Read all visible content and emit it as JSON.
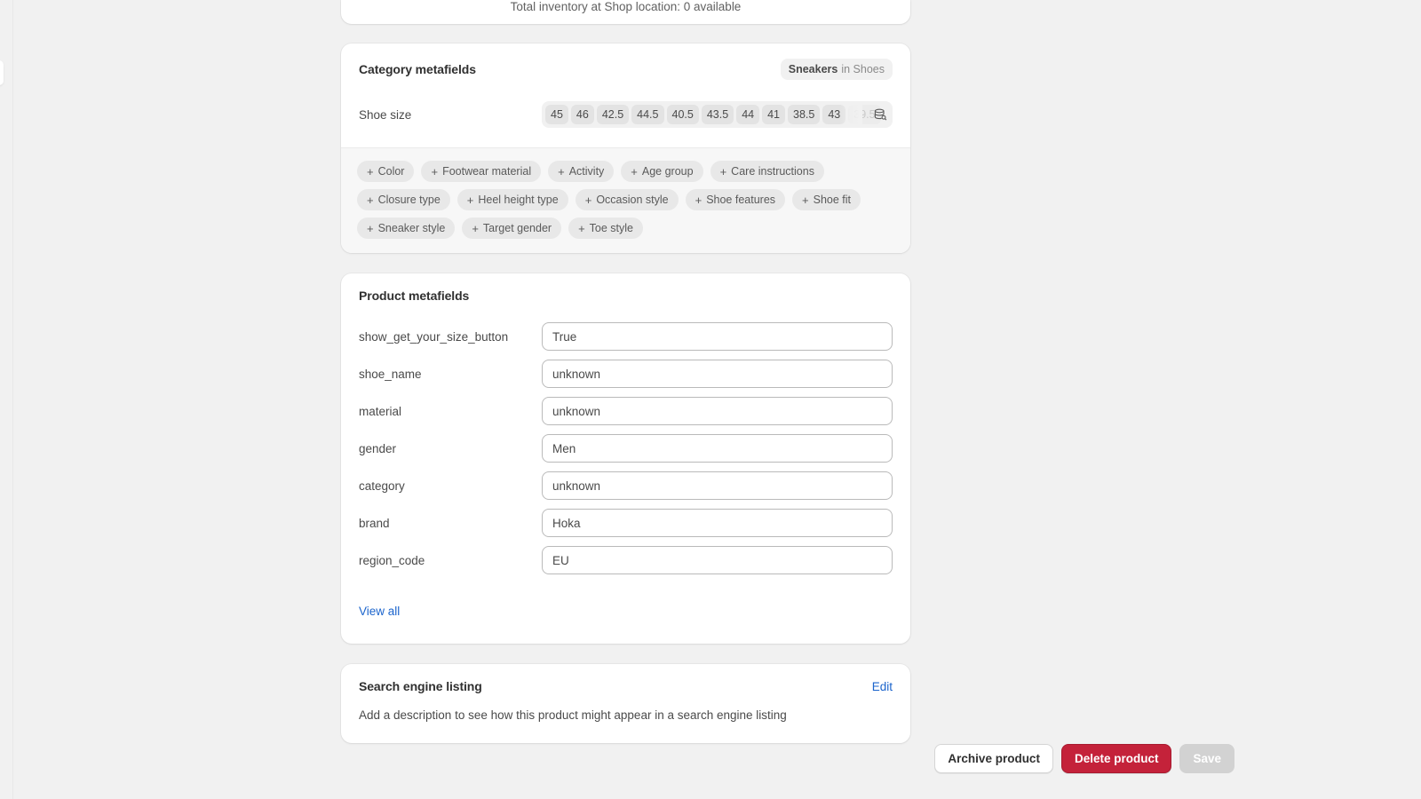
{
  "inventory": {
    "summary": "Total inventory at Shop location: 0 available"
  },
  "category_metafields": {
    "title": "Category metafields",
    "taxonomy_badge": {
      "category": "Sneakers",
      "suffix": "in Shoes"
    },
    "size_field": {
      "label": "Shoe size",
      "values": [
        "45",
        "46",
        "42.5",
        "44.5",
        "40.5",
        "43.5",
        "44",
        "41",
        "38.5",
        "43"
      ],
      "overflow_value": "39.5",
      "icon": "metafield-list-icon"
    },
    "add_chips": [
      "Color",
      "Footwear material",
      "Activity",
      "Age group",
      "Care instructions",
      "Closure type",
      "Heel height type",
      "Occasion style",
      "Shoe features",
      "Shoe fit",
      "Sneaker style",
      "Target gender",
      "Toe style"
    ]
  },
  "product_metafields": {
    "title": "Product metafields",
    "fields": [
      {
        "label": "show_get_your_size_button",
        "value": "True"
      },
      {
        "label": "shoe_name",
        "value": "unknown"
      },
      {
        "label": "material",
        "value": "unknown"
      },
      {
        "label": "gender",
        "value": "Men"
      },
      {
        "label": "category",
        "value": "unknown"
      },
      {
        "label": "brand",
        "value": "Hoka"
      },
      {
        "label": "region_code",
        "value": "EU"
      }
    ],
    "view_all_label": "View all"
  },
  "search_engine_listing": {
    "title": "Search engine listing",
    "edit_label": "Edit",
    "description": "Add a description to see how this product might appear in a search engine listing"
  },
  "actions": {
    "archive_label": "Archive product",
    "delete_label": "Delete product",
    "save_label": "Save"
  },
  "colors": {
    "background": "#F1F1F1",
    "card": "#FFFFFF",
    "link": "#1B64CC",
    "critical": "#C4223A",
    "disabled": "#D2D2D2"
  }
}
